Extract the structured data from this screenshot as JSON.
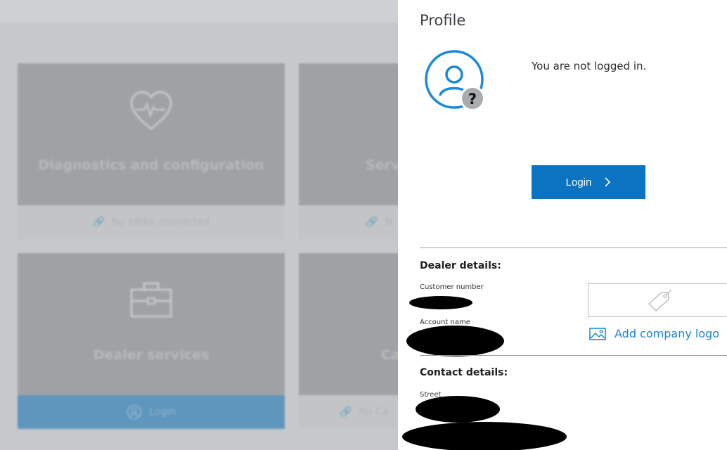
{
  "background": {
    "tiles": [
      {
        "label": "Diagnostics and configuration",
        "footer": "No eBike connected",
        "icon": "heart-pulse-icon",
        "footer_icon": "link-icon"
      },
      {
        "label": "Servi",
        "footer": "N",
        "icon": "",
        "footer_icon": "link-icon"
      },
      {
        "label": "Dealer services",
        "footer": "Login",
        "icon": "briefcase-icon",
        "footer_icon": "user-icon"
      },
      {
        "label": "Ca",
        "footer": "No Ca",
        "icon": "",
        "footer_icon": "link-icon"
      }
    ]
  },
  "profile": {
    "title": "Profile",
    "avatar_icon": "unknown-user-icon",
    "status_text": "You are not logged in.",
    "login_button_label": "Login",
    "login_button_icon": "chevron-right-icon",
    "dealer": {
      "heading": "Dealer details:",
      "customer_number_label": "Customer number",
      "account_name_label": "Account name",
      "logo_placeholder_icon": "brand-tag-icon",
      "add_logo_label": "Add company logo",
      "add_logo_icon": "image-icon"
    },
    "contact": {
      "heading": "Contact details:",
      "street_label": "Street"
    }
  },
  "colors": {
    "primary": "#0a73c2",
    "accent_link": "#1d86cc",
    "panel_bg": "#ffffff",
    "overlay_bg": "#c7c8ca"
  }
}
